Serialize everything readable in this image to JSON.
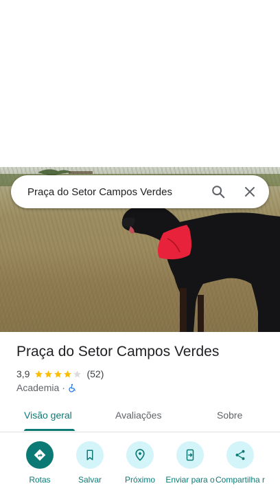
{
  "search": {
    "query": "Praça do Setor Campos Verdes"
  },
  "place": {
    "name": "Praça do Setor Campos Verdes",
    "rating": "3,9",
    "stars_filled": 4,
    "stars_total": 5,
    "review_count": "(52)",
    "category": "Academia",
    "separator": "·"
  },
  "tabs": [
    {
      "label": "Visão geral",
      "active": true
    },
    {
      "label": "Avaliações",
      "active": false
    },
    {
      "label": "Sobre",
      "active": false
    }
  ],
  "actions": [
    {
      "label": "Rotas",
      "icon": "directions-icon"
    },
    {
      "label": "Salvar",
      "icon": "bookmark-icon"
    },
    {
      "label": "Próximo",
      "icon": "nearby-icon"
    },
    {
      "label": "Enviar para o",
      "icon": "send-to-phone-icon"
    },
    {
      "label": "Compartilha r",
      "icon": "share-icon"
    }
  ],
  "colors": {
    "accent": "#0b7a75",
    "action_bg": "#d3f4f8",
    "star": "#fbbc04",
    "accessibility": "#1a73e8"
  }
}
